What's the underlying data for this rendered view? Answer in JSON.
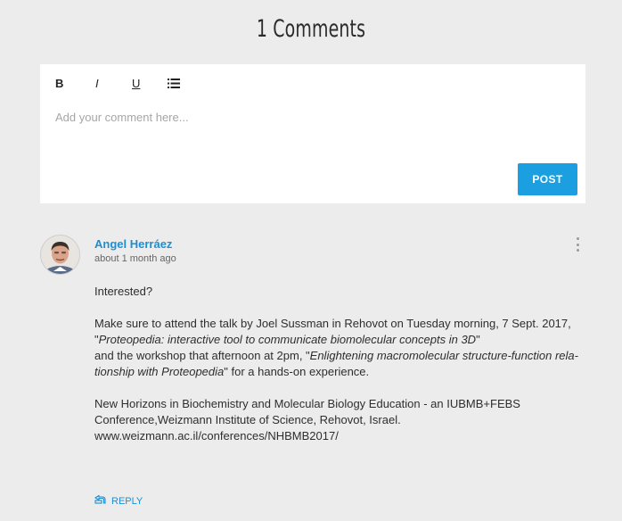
{
  "header": {
    "title": "1 Comments"
  },
  "editor": {
    "toolbar": {
      "bold": "B",
      "italic": "I",
      "underline": "U"
    },
    "placeholder": "Add your comment here...",
    "post_label": "POST"
  },
  "comment": {
    "author": "Angel Herráez",
    "time": "about 1 month ago",
    "body": {
      "line1": "Interested?",
      "line2": "Make sure to attend the talk by Joel Sussman in Rehovot on Tuesday morning, 7 Sept. 2017, \"",
      "title1": "Proteopedia: interactive tool to communicate biomolecular concepts in 3D",
      "line2b": "\"",
      "line3": "and the workshop that afternoon at 2pm, \"",
      "title2": "Enlightening macromolecular structure-function rela-tionship with Proteopedia",
      "line3b": "\" for a hands-on experience.",
      "line4": "New Horizons in Biochemistry and Molecular Biology Education - an IUBMB+FEBS Conference,Weizmann Institute of Science, Rehovot, Israel.",
      "line5": "www.weizmann.ac.il/conferences/NHBMB2017/"
    },
    "reply_label": "REPLY"
  },
  "colors": {
    "accent": "#1b9fe0",
    "link": "#1b8fd2",
    "background": "#ececec"
  },
  "icons": {
    "list": "list-icon",
    "reply": "reply-icon",
    "more": "more-vertical-icon"
  }
}
